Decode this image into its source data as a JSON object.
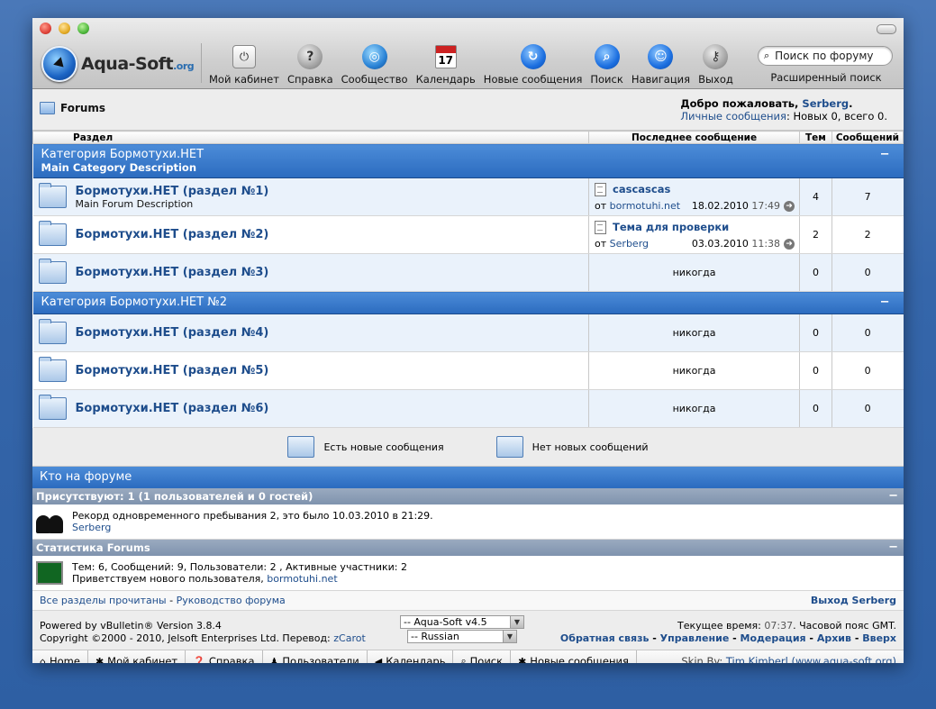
{
  "toolbar": {
    "items": [
      {
        "label": "Мой кабинет",
        "icon": "switch-icon"
      },
      {
        "label": "Справка",
        "icon": "help-icon"
      },
      {
        "label": "Сообщество",
        "icon": "globe-icon"
      },
      {
        "label": "Календарь",
        "icon": "calendar-icon",
        "day": "17"
      },
      {
        "label": "Новые сообщения",
        "icon": "refresh-icon"
      },
      {
        "label": "Поиск",
        "icon": "magnifier-icon"
      },
      {
        "label": "Навигация",
        "icon": "accessibility-icon"
      },
      {
        "label": "Выход",
        "icon": "keys-icon"
      }
    ],
    "search_placeholder": "Поиск по форуму",
    "advanced_search": "Расширенный поиск"
  },
  "logo": {
    "text": "Aqua-Soft",
    "suffix": ".org"
  },
  "breadcrumb": {
    "title": "Forums"
  },
  "welcome": {
    "prefix": "Добро пожаловать, ",
    "user": "Serberg",
    "dot": ".",
    "pm_link": "Личные сообщения",
    "pm_text": ": Новых 0, всего 0."
  },
  "table_headers": {
    "section": "Раздел",
    "last_post": "Последнее сообщение",
    "threads": "Тем",
    "posts": "Сообщений"
  },
  "categories": [
    {
      "title": "Категория Бормотухи.НЕТ",
      "desc": "Main Category Description",
      "collapse": "−",
      "forums": [
        {
          "title": "Бормотухи.НЕТ (раздел №1)",
          "desc": "Main Forum Description",
          "lp_title": "cascascas",
          "lp_by": "от ",
          "lp_user": "bormotuhi.net",
          "lp_date": "18.02.2010",
          "lp_time": "17:49",
          "threads": "4",
          "posts": "7"
        },
        {
          "title": "Бормотухи.НЕТ (раздел №2)",
          "desc": "",
          "lp_title": "Тема для проверки",
          "lp_by": "от ",
          "lp_user": "Serberg",
          "lp_date": "03.03.2010",
          "lp_time": "11:38",
          "threads": "2",
          "posts": "2"
        },
        {
          "title": "Бормотухи.НЕТ (раздел №3)",
          "desc": "",
          "never": "никогда",
          "threads": "0",
          "posts": "0"
        }
      ]
    },
    {
      "title": "Категория Бормотухи.НЕТ №2",
      "desc": "",
      "collapse": "−",
      "forums": [
        {
          "title": "Бормотухи.НЕТ (раздел №4)",
          "never": "никогда",
          "threads": "0",
          "posts": "0"
        },
        {
          "title": "Бормотухи.НЕТ (раздел №5)",
          "never": "никогда",
          "threads": "0",
          "posts": "0"
        },
        {
          "title": "Бормотухи.НЕТ (раздел №6)",
          "never": "никогда",
          "threads": "0",
          "posts": "0"
        }
      ]
    }
  ],
  "legend": {
    "new": "Есть новые сообщения",
    "none": "Нет новых сообщений"
  },
  "who": {
    "title": "Кто на форуме",
    "present": "Присутствуют: 1 (1 пользователей и 0 гостей)",
    "record": "Рекорд одновременного пребывания 2, это было 10.03.2010 в 21:29.",
    "online_user": "Serberg",
    "stats_title": "Статистика Forums",
    "stats": "Тем: 6, Сообщений: 9, Пользователи: 2 , Активные участники: 2",
    "welcome_new": "Приветствуем нового пользователя, ",
    "new_user": "bormotuhi.net",
    "collapse": "−"
  },
  "links": {
    "mark_read": "Все разделы прочитаны",
    "sep": " - ",
    "rules": "Руководство форума",
    "logout": "Выход Serberg"
  },
  "footer": {
    "powered": "Powered by vBulletin® Version 3.8.4",
    "copyright": "Copyright ©2000 - 2010, Jelsoft Enterprises Ltd. Перевод: ",
    "translator": "zCarot",
    "style_select": "-- Aqua-Soft v4.5",
    "lang_select": "-- Russian",
    "time_prefix": "Текущее время: ",
    "time": "07:37",
    "time_suffix": ". Часовой пояс GMT.",
    "links": [
      "Обратная связь",
      "Управление",
      "Модерация",
      "Архив",
      "Вверх"
    ]
  },
  "navbar": {
    "items": [
      "Home",
      "Мой кабинет",
      "Справка",
      "Пользователи",
      "Календарь",
      "Поиск",
      "Новые сообщения"
    ],
    "skin_by": "Skin By: ",
    "skin_link": "Tim Kimberl (www.aqua-soft.org)"
  }
}
